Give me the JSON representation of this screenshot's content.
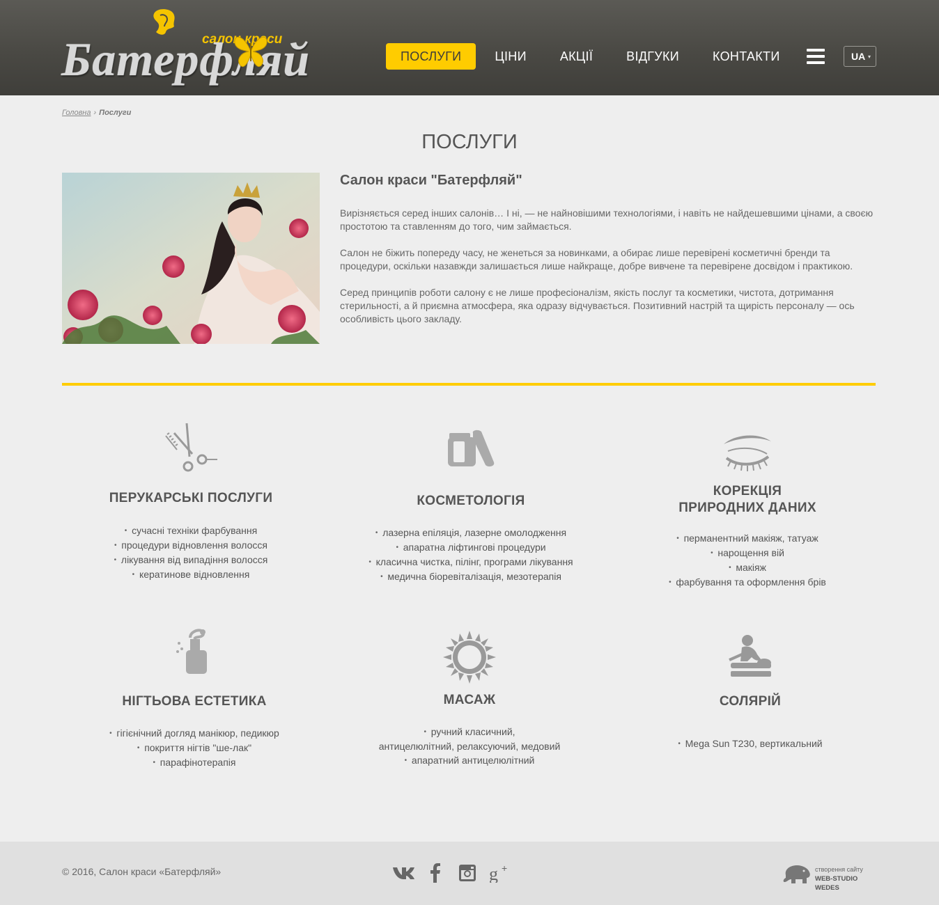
{
  "brand": {
    "subtitle": "салон краси",
    "name": "Батерфляй",
    "accent_color": "#ffcc00",
    "header_color": "#4a4944"
  },
  "nav": {
    "items": [
      {
        "label": "ПОСЛУГИ",
        "active": true
      },
      {
        "label": "ЦІНИ",
        "active": false
      },
      {
        "label": "АКЦІЇ",
        "active": false
      },
      {
        "label": "ВІДГУКИ",
        "active": false
      },
      {
        "label": "КОНТАКТИ",
        "active": false
      }
    ],
    "menu_icon": "hamburger-icon",
    "language": "UA"
  },
  "breadcrumb": {
    "home": "Головна",
    "separator": "›",
    "current": "Послуги"
  },
  "page": {
    "title": "ПОСЛУГИ",
    "intro_heading": "Салон краси \"Батерфляй\"",
    "paragraphs": [
      "Вирізняється серед інших салонів… І ні, — не найновішими технологіями, і навіть не найдешевшими цінами, а своєю простотою та ставленням до того, чим займається.",
      "Салон не біжить попереду часу, не женеться за новинками, а обирає лише перевірені косметичні бренди та процедури, оскільки назавжди залишається лише найкраще, добре вивчене та перевірене досвідом і практикою.",
      "Серед принципів роботи салону є не лише професіоналізм, якість послуг та косметики, чистота, дотримання стерильності, а й приємна атмосфера, яка одразу відчувається. Позитивний настрій та щирість персоналу — ось особливість цього закладу."
    ]
  },
  "services": [
    {
      "icon": "scissors-comb-icon",
      "title": "ПЕРУКАРСЬКІ ПОСЛУГИ",
      "items": [
        "сучасні техніки фарбування",
        "процедури відновлення волосся",
        "лікування від випадіння волосся",
        "кератинове відновлення"
      ]
    },
    {
      "icon": "cosmetics-jars-icon",
      "title": "КОСМЕТОЛОГІЯ",
      "items": [
        "лазерна епіляція, лазерне омолодження",
        "апаратна ліфтингові процедури",
        "класична чистка, пілінг, програми лікування",
        "медична біоревіталізація, мезотерапія"
      ]
    },
    {
      "icon": "eyebrow-lashes-icon",
      "title_line1": "КОРЕКЦІЯ",
      "title_line2": "ПРИРОДНИХ ДАНИХ",
      "items": [
        "перманентний макіяж, татуаж",
        "нарощення вій",
        "макіяж",
        "фарбування та оформлення брів"
      ]
    },
    {
      "icon": "nail-polish-bottle-icon",
      "title": "НІГТЬОВА ЕСТЕТИКА",
      "items": [
        "гігієнічний догляд  манікюр, педикюр",
        "покриття нігтів \"ше-лак\"",
        "парафінотерапія"
      ]
    },
    {
      "icon": "sun-icon",
      "title": "МАСАЖ",
      "items": [
        "ручний  класичний,"
      ],
      "item_continuation": "антицелюлітний, релаксуючий, медовий",
      "items_after": [
        "апаратний  антицелюлітний"
      ]
    },
    {
      "icon": "massage-person-icon",
      "title": "СОЛЯРІЙ",
      "items": [
        "Mega Sun T230, вертикальний"
      ]
    }
  ],
  "footer": {
    "copyright": "© 2016, Салон краси «Батерфляй»",
    "socials": [
      "vk-icon",
      "facebook-icon",
      "instagram-icon",
      "google-plus-icon"
    ],
    "studio_line1": "створення сайту",
    "studio_line2": "WEB-STUDIO WEDES"
  }
}
